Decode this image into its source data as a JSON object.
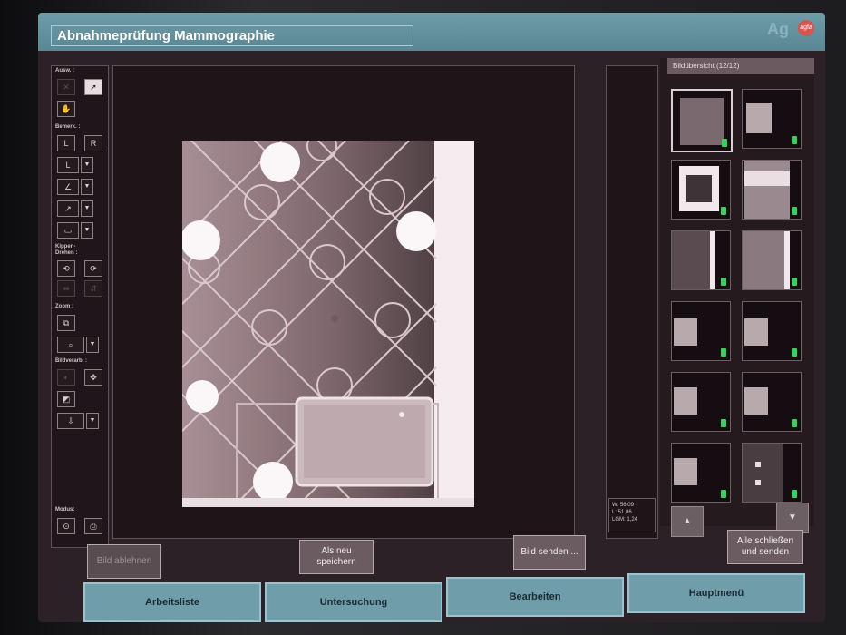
{
  "window": {
    "title": "Abnahmeprüfung Mammographie",
    "brand": "Ag",
    "logo_text": "agfa"
  },
  "toolbar": {
    "groups": {
      "auswahl": "Ausw. :",
      "bemerk": "Bemerk. :",
      "kippen": "Kippen-",
      "drehen": "Drehen :",
      "zoom": "Zoom :",
      "bildverarb": "Bildverarb. :",
      "modus": "Modus:"
    },
    "btn_l": "L",
    "btn_r": "R",
    "btn_l2": "L"
  },
  "info": {
    "w": "W: 56,09",
    "l": "L: 51,86",
    "lgm": "LGM: 1,24"
  },
  "thumbs": {
    "header": "Bildübersicht (12/12)",
    "count": 12,
    "selected_index": 0
  },
  "buttons": {
    "reject": "Bild ablehnen",
    "save_new": "Als neu\nspeichern",
    "send": "Bild senden ...",
    "close_send": "Alle schließen\nund senden"
  },
  "tabs": [
    "Arbeitsliste",
    "Untersuchung",
    "Bearbeiten",
    "Hauptmenü"
  ],
  "colors": {
    "tab": "#6f9da9",
    "indicator": "#32d35e",
    "background": "#2c2126"
  }
}
